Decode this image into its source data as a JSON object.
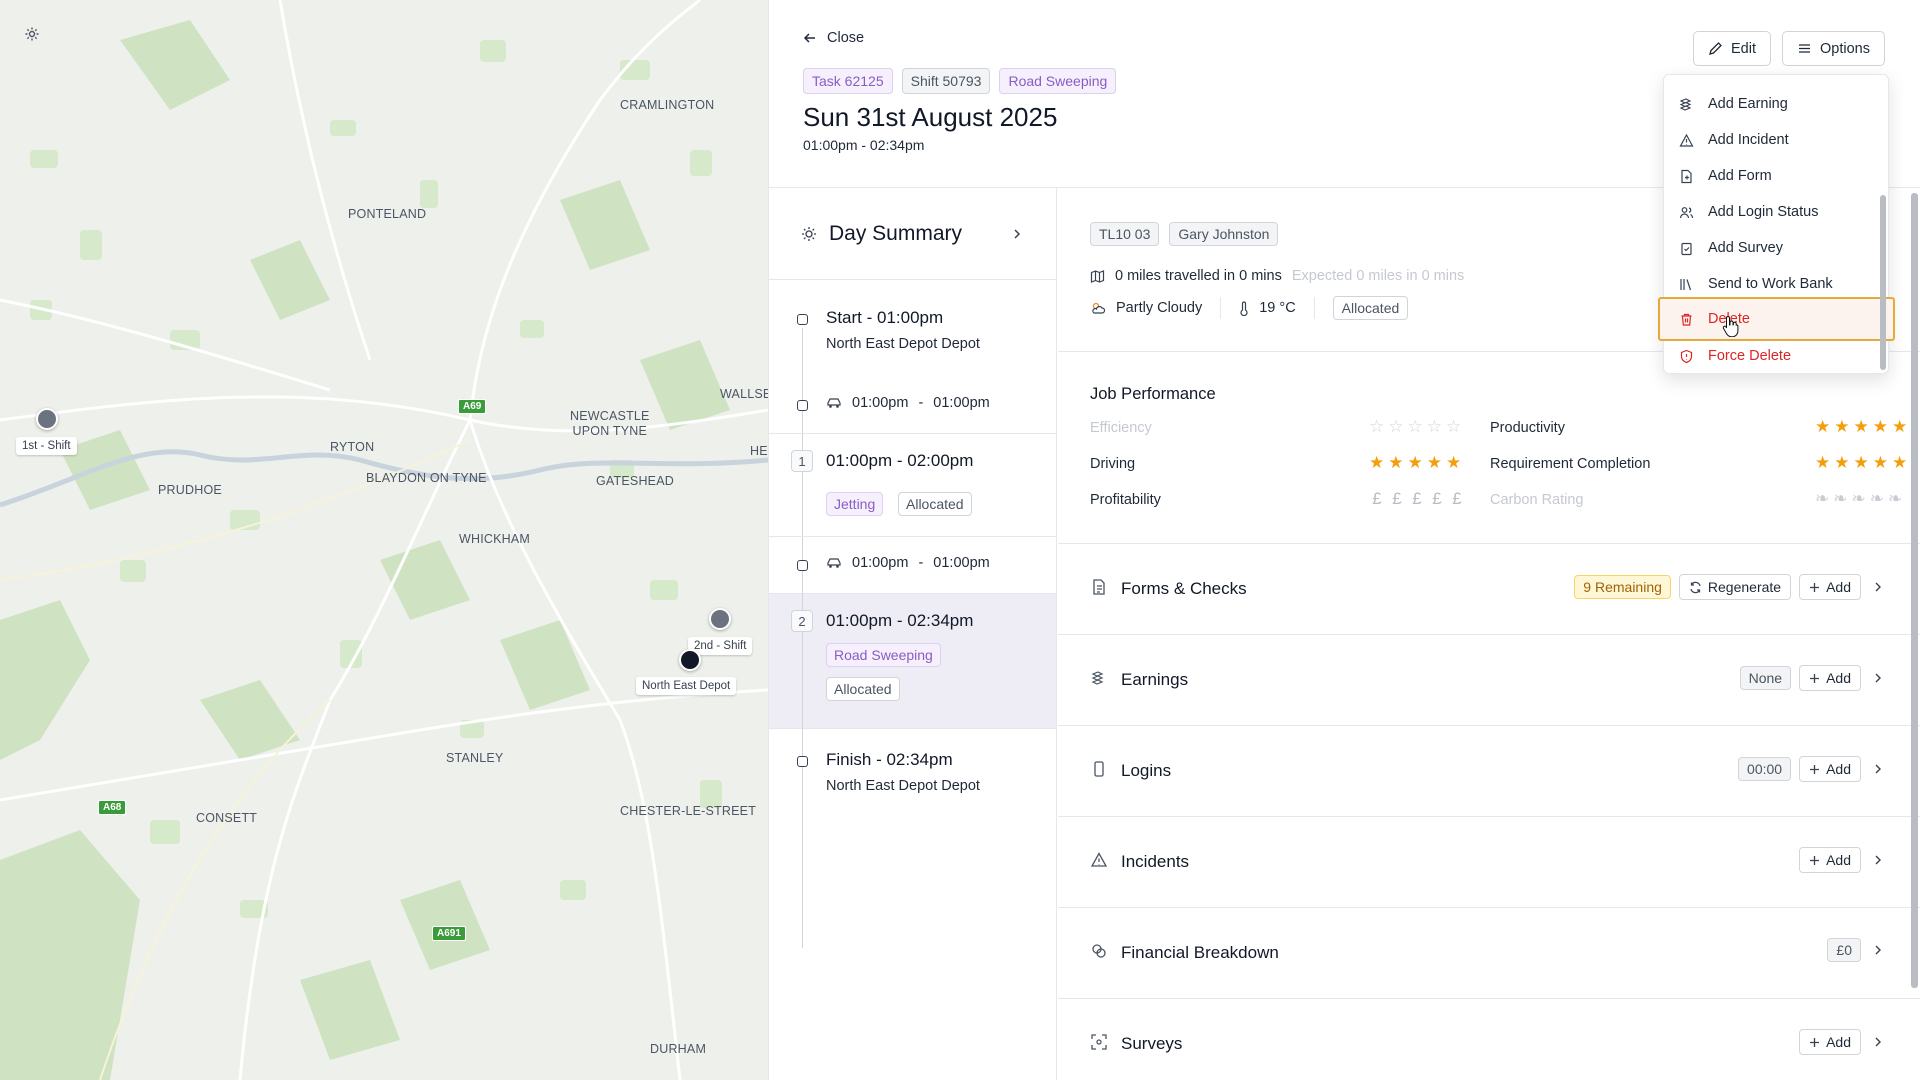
{
  "map": {
    "settings_icon": "gear-icon",
    "places": {
      "cramlington": "CRAMLINGTON",
      "ponteland": "PONTELAND",
      "wallsend": "WALLSE",
      "newcastle": "NEWCASTLE\nUPON TYNE",
      "ryton": "RYTON",
      "blaydon": "BLAYDON ON TYNE",
      "gateshead": "GATESHEAD",
      "prudhoe": "PRUDHOE",
      "whickham": "WHICKHAM",
      "stanley": "STANLEY",
      "consett": "CONSETT",
      "chester": "CHESTER-LE-STREET",
      "durham": "DURHAM",
      "he": "HE"
    },
    "roads": {
      "a69": "A69",
      "a68": "A68",
      "a691": "A691"
    },
    "markers": {
      "shift1": "1st - Shift",
      "shift2": "2nd - Shift",
      "depot": "North East Depot"
    }
  },
  "header": {
    "close_label": "Close",
    "tags": {
      "task": "Task 62125",
      "shift": "Shift 50793",
      "type": "Road Sweeping"
    },
    "date": "Sun 31st August 2025",
    "time_range": "01:00pm - 02:34pm",
    "edit_label": "Edit",
    "options_label": "Options"
  },
  "options_menu": {
    "add_earning": "Add Earning",
    "add_incident": "Add Incident",
    "add_form": "Add Form",
    "add_login_status": "Add Login Status",
    "add_survey": "Add Survey",
    "send_work_bank": "Send to Work Bank",
    "delete": "Delete",
    "force_delete": "Force Delete"
  },
  "timeline": {
    "title": "Day Summary",
    "start": {
      "label": "Start - 01:00pm",
      "location": "North East Depot Depot"
    },
    "travel1": {
      "from": "01:00pm",
      "sep": "-",
      "to": "01:00pm"
    },
    "job1": {
      "num": "1",
      "time": "01:00pm - 02:00pm",
      "type": "Jetting",
      "status": "Allocated"
    },
    "travel2": {
      "from": "01:00pm",
      "sep": "-",
      "to": "01:00pm"
    },
    "job2": {
      "num": "2",
      "time": "01:00pm - 02:34pm",
      "type": "Road Sweeping",
      "status": "Allocated"
    },
    "finish": {
      "label": "Finish - 02:34pm",
      "location": "North East Depot Depot"
    }
  },
  "detail": {
    "vehicle": "TL10 03",
    "driver": "Gary Johnston",
    "miles_text": "0 miles travelled in 0 mins",
    "expected_text": "Expected 0 miles in 0 mins",
    "weather": "Partly Cloudy",
    "temperature": "19 °C",
    "status": "Allocated"
  },
  "performance": {
    "title": "Job Performance",
    "efficiency_label": "Efficiency",
    "efficiency_stars": 0,
    "productivity_label": "Productivity",
    "productivity_stars": 5,
    "driving_label": "Driving",
    "driving_stars": 5,
    "requirement_label": "Requirement Completion",
    "requirement_stars": 5,
    "profitability_label": "Profitability",
    "profitability_level": 0,
    "carbon_label": "Carbon Rating",
    "carbon_level": 0
  },
  "sections": {
    "forms": {
      "title": "Forms & Checks",
      "remaining": "9 Remaining",
      "regenerate": "Regenerate",
      "add": "Add"
    },
    "earnings": {
      "title": "Earnings",
      "value": "None",
      "add": "Add"
    },
    "logins": {
      "title": "Logins",
      "value": "00:00",
      "add": "Add"
    },
    "incidents": {
      "title": "Incidents",
      "add": "Add"
    },
    "financial": {
      "title": "Financial Breakdown",
      "value": "£0"
    },
    "surveys": {
      "title": "Surveys",
      "add": "Add"
    }
  }
}
